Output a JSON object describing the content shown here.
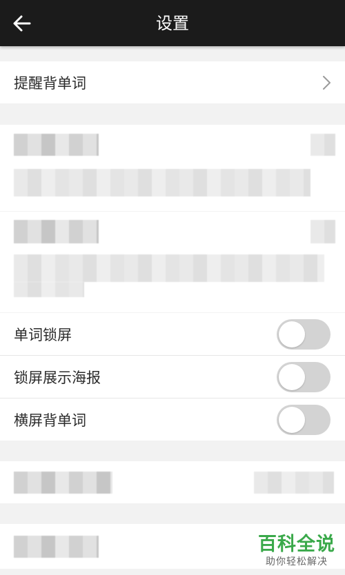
{
  "header": {
    "title": "设置",
    "back_icon": "arrow-left-icon"
  },
  "reminder_row": {
    "label": "提醒背单词",
    "chevron_icon": "chevron-right-icon"
  },
  "toggles": [
    {
      "label": "单词锁屏",
      "on": false
    },
    {
      "label": "锁屏展示海报",
      "on": false
    },
    {
      "label": "横屏背单词",
      "on": false
    }
  ],
  "watermark": {
    "title": "百科全说",
    "subtitle": "助你轻松解决"
  },
  "colors": {
    "topbar": "#1b1b1b",
    "toggle_off": "#d3d3d3",
    "watermark": "#3aa94a"
  }
}
